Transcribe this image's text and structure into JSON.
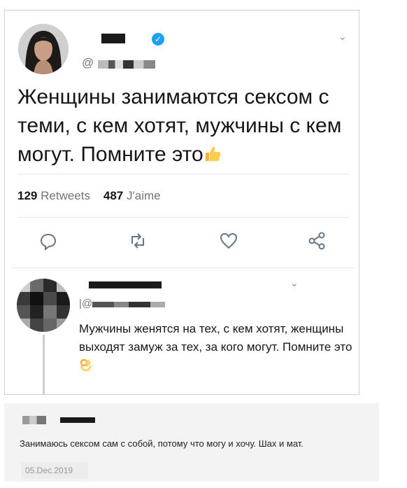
{
  "tweet": {
    "handle_prefix": "@",
    "text": "Женщины занимаются сексом с теми, с кем хотят, мужчины с кем могут. Помните это",
    "retweets_count": "129",
    "retweets_label": "Retweets",
    "likes_count": "487",
    "likes_label": "J'aime",
    "verified_icon": "✓"
  },
  "reply": {
    "handle": "|@",
    "text": "Мужчины женятся на тех, с кем хотят, женщины выходят замуж за тех, за кого могут. Помните это"
  },
  "comment": {
    "text": "Занимаюсь сексом сам с собой, потому что могу и хочу. Шах и мат.",
    "date": "05.Dec.2019"
  },
  "icons": [
    "reply-icon",
    "retweet-icon",
    "like-icon",
    "share-icon",
    "thumbs-up-icon",
    "ok-hand-icon",
    "verified-badge-icon",
    "chevron-down-icon"
  ],
  "colors": {
    "accent": "#1da1f2",
    "text": "#14171a",
    "muted": "#6e767d"
  }
}
